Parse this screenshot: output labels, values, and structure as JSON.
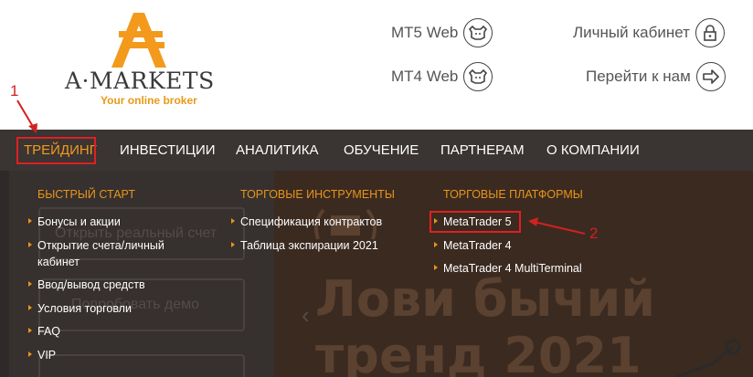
{
  "brand": {
    "name": "A·MARKETS",
    "tagline": "Your online broker",
    "color_orange": "#f39a1d"
  },
  "header_links": [
    {
      "label": "MT5 Web",
      "icon": "bull-icon"
    },
    {
      "label": "Личный кабинет",
      "icon": "lock-icon"
    },
    {
      "label": "MT4 Web",
      "icon": "bull-icon"
    },
    {
      "label": "Перейти к нам",
      "icon": "arrow-right-icon"
    }
  ],
  "nav": {
    "items": [
      "ТРЕЙДИНГ",
      "ИНВЕСТИЦИИ",
      "АНАЛИТИКА",
      "ОБУЧЕНИЕ",
      "ПАРТНЕРАМ",
      "О КОМПАНИИ"
    ],
    "active": "ТРЕЙДИНГ"
  },
  "annotations": {
    "step1": "1",
    "step2": "2",
    "color": "#e02020"
  },
  "dropdown": {
    "col1": {
      "title": "БЫСТРЫЙ СТАРТ",
      "items": [
        "Бонусы и акции",
        "Открытие счета/личный",
        "кабинет",
        "Ввод/вывод средств",
        "Условия торговли",
        "FAQ",
        "VIP"
      ]
    },
    "col2": {
      "title": "ТОРГОВЫЕ ИНСТРУМЕНТЫ",
      "items": [
        "Спецификация контрактов",
        "Таблица экспирации 2021"
      ]
    },
    "col3": {
      "title": "ТОРГОВЫЕ ПЛАТФОРМЫ",
      "items": [
        "MetaTrader 5",
        "MetaTrader 4",
        "MetaTrader 4 MultiTerminal"
      ]
    }
  },
  "background": {
    "ghost_open": "Открыть реальный счет",
    "ghost_demo": "Попробовать демо",
    "promo_line1": "Лови бычий",
    "promo_line2": "тренд 2021"
  }
}
